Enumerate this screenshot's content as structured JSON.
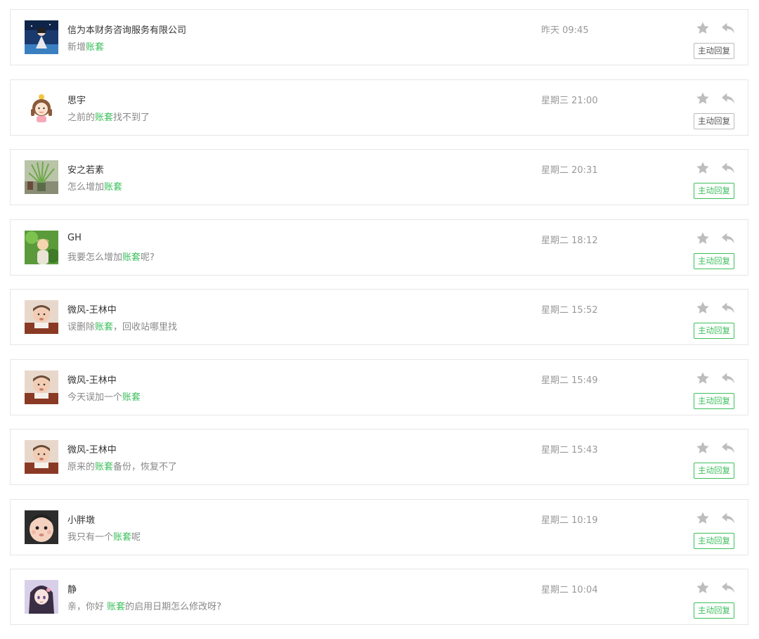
{
  "colors": {
    "keyword": "#3cbf5c",
    "active_button": "#3cbf5c",
    "muted_icon": "#bbbbbb"
  },
  "icons": {
    "favorite": "star-icon",
    "reply": "reply-arrow-icon"
  },
  "messages": [
    {
      "name": "信为本财务咨询服务有限公司",
      "msg_before": "新增",
      "keyword": "账套",
      "msg_after": "",
      "time": "昨天 09:45",
      "button": "主动回复",
      "button_active": false,
      "avatar": "anime-night-figure"
    },
    {
      "name": "思宇",
      "msg_before": "之前的",
      "keyword": "账套",
      "msg_after": "找不到了",
      "time": "星期三 21:00",
      "button": "主动回复",
      "button_active": false,
      "avatar": "cartoon-girl"
    },
    {
      "name": "安之若素",
      "msg_before": "怎么增加",
      "keyword": "账套",
      "msg_after": "",
      "time": "星期二 20:31",
      "button": "主动回复",
      "button_active": true,
      "avatar": "grass-plant"
    },
    {
      "name": "GH",
      "msg_before": "我要怎么增加",
      "keyword": "账套",
      "msg_after": "呢?",
      "time": "星期二 18:12",
      "button": "主动回复",
      "button_active": true,
      "avatar": "child-outdoors"
    },
    {
      "name": "微风-王林中",
      "msg_before": "误删除",
      "keyword": "账套",
      "msg_after": "，回收站哪里找",
      "time": "星期二 15:52",
      "button": "主动回复",
      "button_active": true,
      "avatar": "baby-photo"
    },
    {
      "name": "微风-王林中",
      "msg_before": "今天误加一个",
      "keyword": "账套",
      "msg_after": "",
      "time": "星期二 15:49",
      "button": "主动回复",
      "button_active": true,
      "avatar": "baby-photo"
    },
    {
      "name": "微风-王林中",
      "msg_before": "原来的",
      "keyword": "账套",
      "msg_after": "备份，恢复不了",
      "time": "星期二 15:43",
      "button": "主动回复",
      "button_active": true,
      "avatar": "baby-photo"
    },
    {
      "name": "小胖墩",
      "msg_before": "我只有一个",
      "keyword": "账套",
      "msg_after": "呢",
      "time": "星期二 10:19",
      "button": "主动回复",
      "button_active": true,
      "avatar": "baby-face"
    },
    {
      "name": "静",
      "msg_before": "亲，你好 ",
      "keyword": "账套",
      "msg_after": "的启用日期怎么修改呀?",
      "time": "星期二 10:04",
      "button": "主动回复",
      "button_active": true,
      "avatar": "anime-girl"
    }
  ]
}
